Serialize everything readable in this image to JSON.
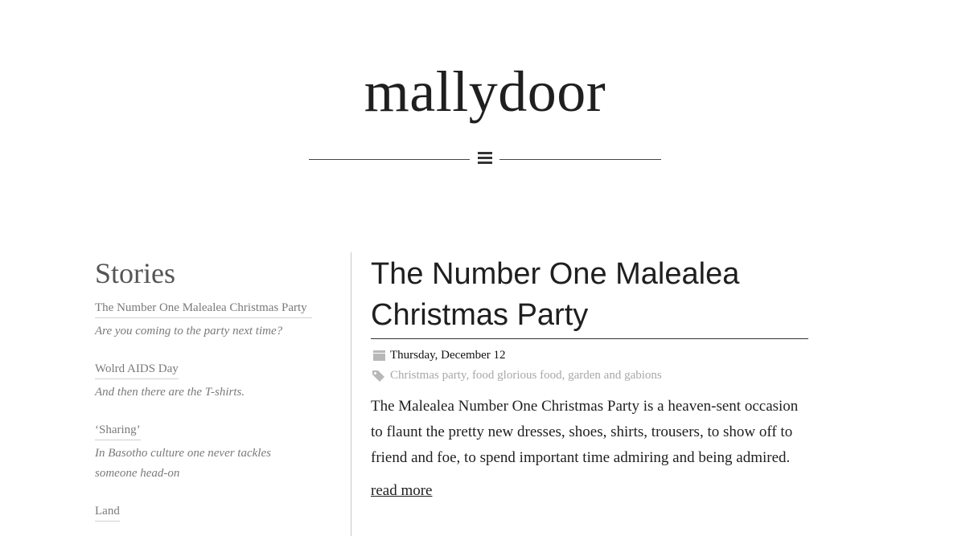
{
  "site": {
    "title": "mallydoor"
  },
  "sidebar": {
    "heading": "Stories",
    "stories": [
      {
        "title": "The Number One Malealea Christmas Party",
        "excerpt": "Are you coming to the party next time?"
      },
      {
        "title": "Wolrd AIDS Day",
        "excerpt": "And then there are the T-shirts."
      },
      {
        "title": "‘Sharing’",
        "excerpt": "In Basotho culture one never tackles someone head-on"
      },
      {
        "title": "Land",
        "excerpt": ""
      }
    ]
  },
  "article": {
    "title": "The Number One Malealea Christmas Party",
    "date": "Thursday, December 12",
    "tags": [
      "Christmas party",
      "food glorious food",
      "garden and gabions"
    ],
    "body": "The Malealea Number One Christmas Party is a heaven-sent occasion to flaunt the pretty new dresses, shoes, shirts, trousers, to show off to friend and foe, to spend important time admiring and being admired.",
    "read_more": "read more"
  },
  "icons": {
    "menu": "hamburger-menu-icon",
    "date": "calendar-icon",
    "tags": "tag-icon"
  },
  "colors": {
    "text": "#1f1f1f",
    "muted": "#7a7a7a",
    "tags": "#a8a8a8",
    "background": "#ffffff"
  }
}
